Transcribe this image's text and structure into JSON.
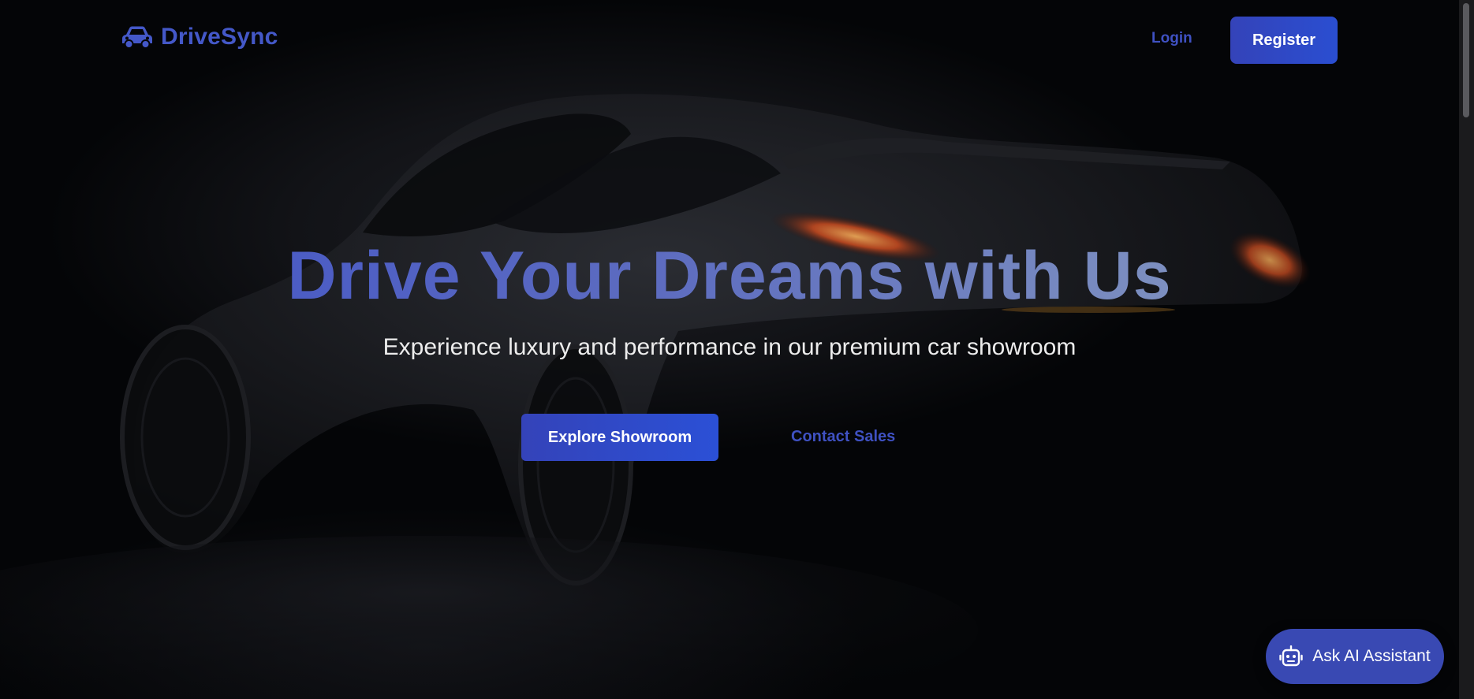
{
  "colors": {
    "accent": "#3f51c2",
    "button_gradient_start": "#3443b9",
    "button_gradient_end": "#2b50d6",
    "background": "#040507",
    "subtitle_text": "#ececec"
  },
  "navbar": {
    "brand_icon": "car-icon",
    "brand_name": "DriveSync",
    "login_label": "Login",
    "register_label": "Register"
  },
  "hero": {
    "title": "Drive Your Dreams with Us",
    "subtitle": "Experience luxury and performance in our premium car showroom",
    "primary_cta": "Explore Showroom",
    "secondary_cta": "Contact Sales"
  },
  "assistant": {
    "icon": "robot-icon",
    "label": "Ask AI Assistant"
  }
}
